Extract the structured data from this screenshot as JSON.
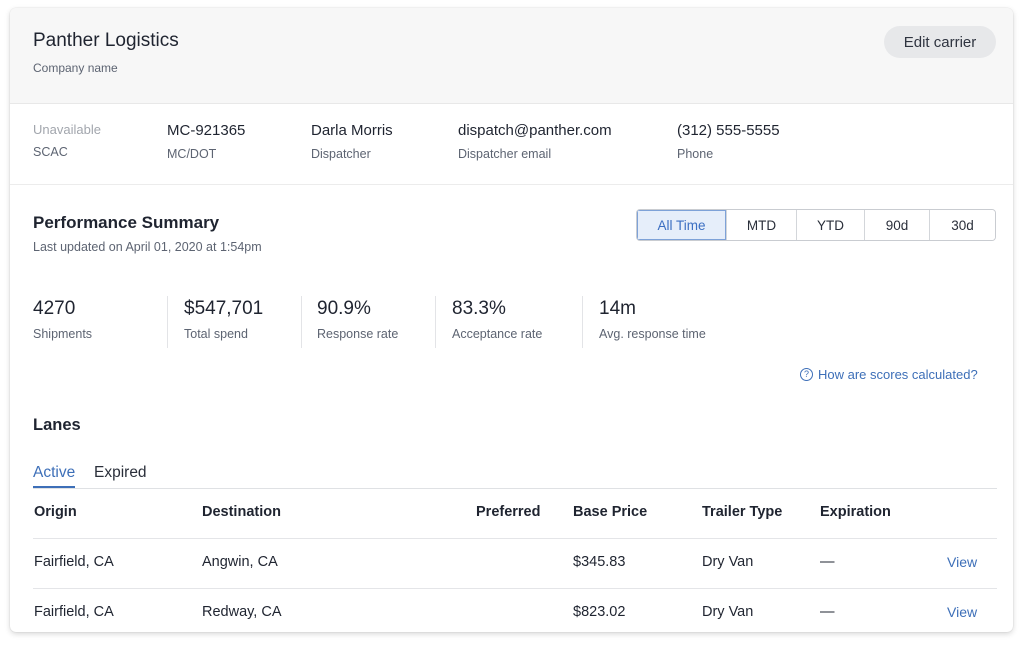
{
  "header": {
    "company_name": "Panther Logistics",
    "company_label": "Company name",
    "edit_button": "Edit carrier"
  },
  "info": [
    {
      "value": "Unavailable",
      "label": "SCAC"
    },
    {
      "value": "MC-921365",
      "label": "MC/DOT"
    },
    {
      "value": "Darla Morris",
      "label": "Dispatcher"
    },
    {
      "value": "dispatch@panther.com",
      "label": "Dispatcher email"
    },
    {
      "value": "(312) 555-5555",
      "label": "Phone"
    }
  ],
  "performance": {
    "title": "Performance Summary",
    "updated": "Last updated on April 01, 2020 at 1:54pm",
    "ranges": [
      "All Time",
      "MTD",
      "YTD",
      "90d",
      "30d"
    ],
    "selected_range": "All Time",
    "stats": [
      {
        "value": "4270",
        "label": "Shipments"
      },
      {
        "value": "$547,701",
        "label": "Total spend"
      },
      {
        "value": "90.9%",
        "label": "Response rate"
      },
      {
        "value": "83.3%",
        "label": "Acceptance rate"
      },
      {
        "value": "14m",
        "label": "Avg. response time"
      }
    ],
    "help_link": "How are scores calculated?"
  },
  "lanes": {
    "title": "Lanes",
    "tabs": [
      "Active",
      "Expired"
    ],
    "active_tab": "Active",
    "columns": [
      "Origin",
      "Destination",
      "Preferred",
      "Base Price",
      "Trailer Type",
      "Expiration"
    ],
    "rows": [
      {
        "origin": "Fairfield, CA",
        "destination": "Angwin, CA",
        "preferred": "",
        "base_price": "$345.83",
        "trailer_type": "Dry Van",
        "expiration": "—",
        "action": "View"
      },
      {
        "origin": "Fairfield, CA",
        "destination": "Redway, CA",
        "preferred": "",
        "base_price": "$823.02",
        "trailer_type": "Dry Van",
        "expiration": "—",
        "action": "View"
      }
    ]
  },
  "colors": {
    "accent": "#3d6fb8",
    "header_bg": "#f7f7f7",
    "selected_segment_bg": "#e6eefa"
  }
}
